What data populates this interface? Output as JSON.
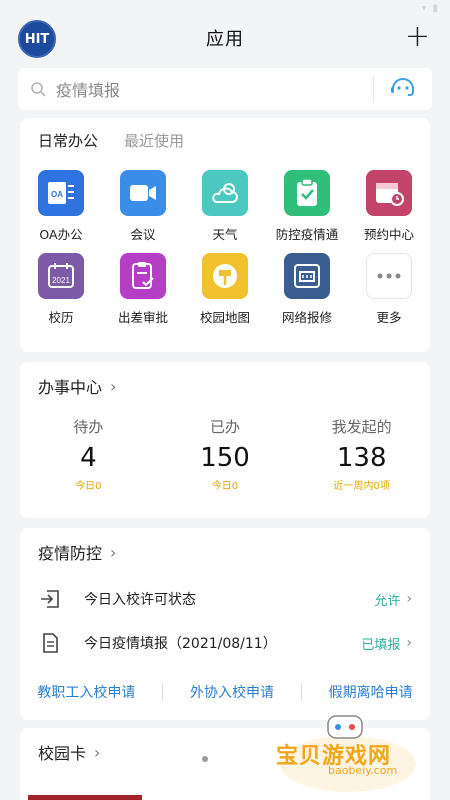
{
  "header": {
    "logo_text": "HIT",
    "title": "应用",
    "add_symbol": "+"
  },
  "search": {
    "placeholder": "疫情填报"
  },
  "daily": {
    "tabs": [
      "日常办公",
      "最近使用"
    ],
    "apps": [
      {
        "label": "OA办公",
        "icon": "oa-icon",
        "color": "#2f73e0"
      },
      {
        "label": "会议",
        "icon": "video-camera-icon",
        "color": "#3a8ee8"
      },
      {
        "label": "天气",
        "icon": "weather-icon",
        "color": "#4cc8c0"
      },
      {
        "label": "防控疫情通",
        "icon": "clipboard-check-icon",
        "color": "#2fbf7a"
      },
      {
        "label": "预约中心",
        "icon": "calendar-clock-icon",
        "color": "#c2446b"
      },
      {
        "label": "校历",
        "icon": "calendar-2021-icon",
        "color": "#7c5aa8"
      },
      {
        "label": "出差审批",
        "icon": "approval-icon",
        "color": "#b43fc4"
      },
      {
        "label": "校园地图",
        "icon": "map-sign-icon",
        "color": "#f2c12e"
      },
      {
        "label": "网络报修",
        "icon": "network-icon",
        "color": "#3b5d92"
      },
      {
        "label": "更多",
        "icon": "more-icon",
        "color": "#ffffff"
      }
    ]
  },
  "office": {
    "title": "办事中心",
    "stats": [
      {
        "label": "待办",
        "value": "4",
        "sub": "今日0"
      },
      {
        "label": "已办",
        "value": "150",
        "sub": "今日0"
      },
      {
        "label": "我发起的",
        "value": "138",
        "sub": "近一周内0项"
      }
    ]
  },
  "epidemic": {
    "title": "疫情防控",
    "rows": [
      {
        "text": "今日入校许可状态",
        "status": "允许"
      },
      {
        "text": "今日疫情填报（2021/08/11）",
        "status": "已填报"
      }
    ],
    "links": [
      "教职工入校申请",
      "外协入校申请",
      "假期离哈申请"
    ]
  },
  "campus": {
    "title": "校园卡"
  },
  "watermark": {
    "title": "宝贝游戏网",
    "url": "baobeiy.com"
  },
  "colors": {
    "accent_teal": "#2bb0a0",
    "link_blue": "#2b7fd4",
    "highlight_yellow": "#e0a800"
  }
}
